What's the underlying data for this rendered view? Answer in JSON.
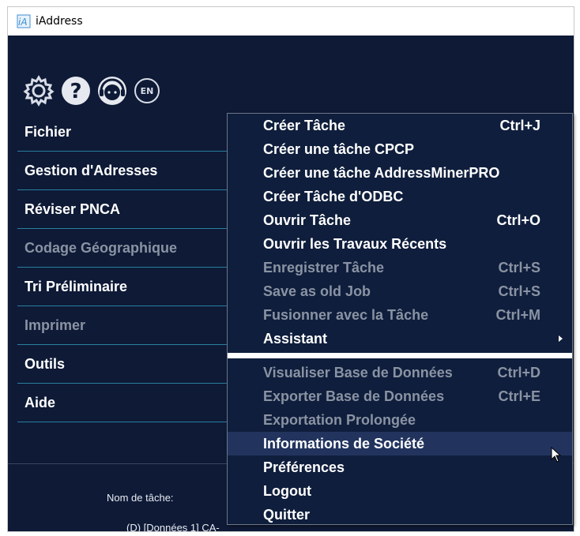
{
  "window": {
    "title": "iAddress",
    "background": "#0e1a36"
  },
  "toolbar": {
    "lang_badge": "EN"
  },
  "sidebar": {
    "items": [
      {
        "label": "Fichier",
        "enabled": true
      },
      {
        "label": "Gestion d'Adresses",
        "enabled": true
      },
      {
        "label": "Réviser PNCA",
        "enabled": true
      },
      {
        "label": "Codage Géographique",
        "enabled": false
      },
      {
        "label": "Tri Préliminaire",
        "enabled": true
      },
      {
        "label": "Imprimer",
        "enabled": false
      },
      {
        "label": "Outils",
        "enabled": true
      },
      {
        "label": "Aide",
        "enabled": true
      }
    ]
  },
  "bottom": {
    "job_name_label": "Nom de tâche:",
    "job_path_partial": "(D) [Données 1] CA-"
  },
  "menu": {
    "items": [
      {
        "label": "Créer Tâche",
        "shortcut": "Ctrl+J"
      },
      {
        "label": "Créer une tâche CPCP",
        "shortcut": ""
      },
      {
        "label": "Créer une tâche AddressMinerPRO",
        "shortcut": ""
      },
      {
        "label": "Créer Tâche d'ODBC",
        "shortcut": ""
      },
      {
        "label": "Ouvrir Tâche",
        "shortcut": "Ctrl+O"
      },
      {
        "label": "Ouvrir les Travaux Récents",
        "shortcut": ""
      },
      {
        "label": "Enregistrer Tâche",
        "shortcut": "Ctrl+S"
      },
      {
        "label": "Save as old Job",
        "shortcut": "Ctrl+S"
      },
      {
        "label": "Fusionner avec la Tâche",
        "shortcut": "Ctrl+M"
      },
      {
        "label": "Assistant",
        "shortcut": ""
      },
      {
        "label": "Visualiser Base de Données",
        "shortcut": "Ctrl+D"
      },
      {
        "label": "Exporter Base de Données",
        "shortcut": "Ctrl+E"
      },
      {
        "label": "Exportation Prolongée",
        "shortcut": ""
      },
      {
        "label": "Informations de Société",
        "shortcut": ""
      },
      {
        "label": "Préférences",
        "shortcut": ""
      },
      {
        "label": "Logout",
        "shortcut": ""
      },
      {
        "label": "Quitter",
        "shortcut": ""
      }
    ],
    "hover_color": "#22345e",
    "disabled_color": "#8a93a3"
  }
}
